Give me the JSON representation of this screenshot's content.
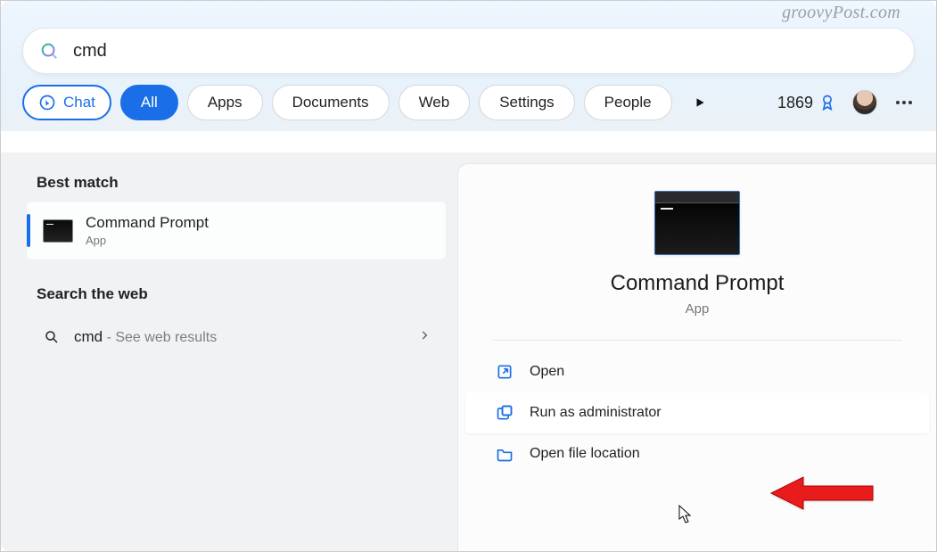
{
  "watermark": "groovyPost.com",
  "search": {
    "value": "cmd",
    "placeholder": ""
  },
  "filters": {
    "chat": "Chat",
    "all": "All",
    "apps": "Apps",
    "documents": "Documents",
    "web": "Web",
    "settings": "Settings",
    "people": "People"
  },
  "rewards": {
    "points": "1869"
  },
  "left": {
    "best_match_label": "Best match",
    "best_match": {
      "title": "Command Prompt",
      "subtitle": "App"
    },
    "search_web_label": "Search the web",
    "web_result": {
      "term": "cmd",
      "suffix": "- See web results"
    }
  },
  "preview": {
    "title": "Command Prompt",
    "subtitle": "App",
    "actions": {
      "open": "Open",
      "run_admin": "Run as administrator",
      "open_file_location": "Open file location"
    }
  }
}
